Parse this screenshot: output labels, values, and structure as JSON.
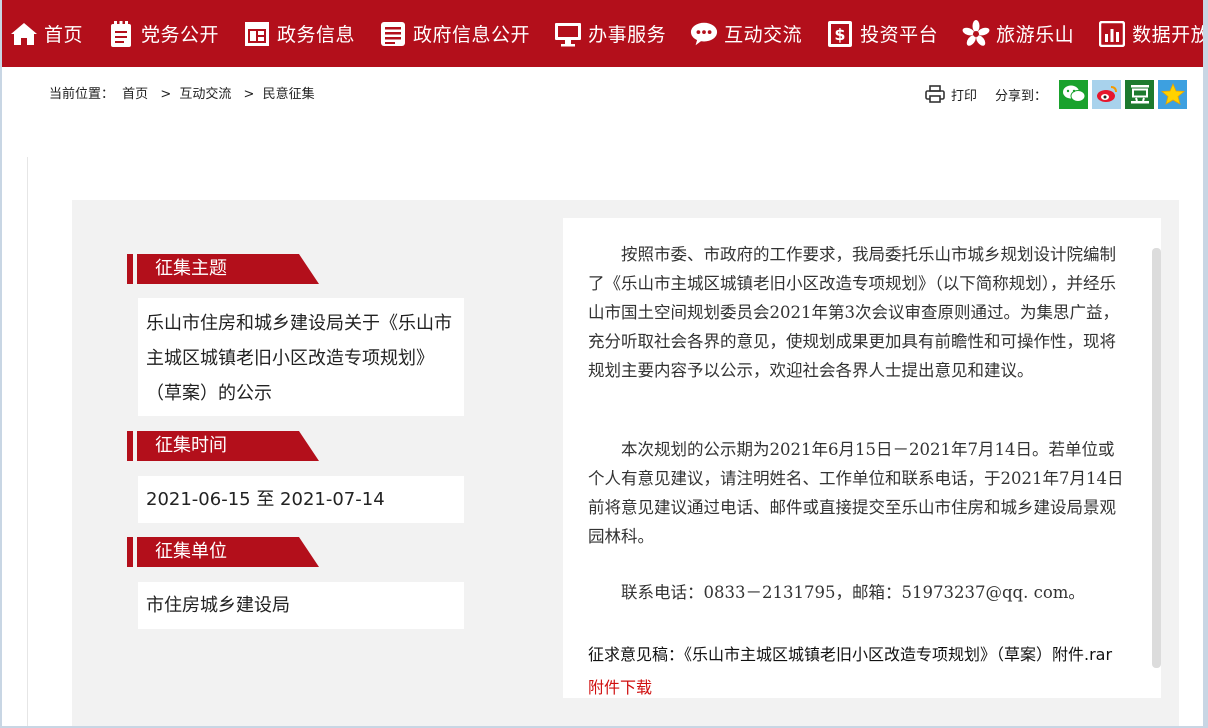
{
  "nav": {
    "items": [
      {
        "label": "首页",
        "icon": "home-icon"
      },
      {
        "label": "党务公开",
        "icon": "notepad-icon"
      },
      {
        "label": "政务信息",
        "icon": "window-layout-icon"
      },
      {
        "label": "政府信息公开",
        "icon": "list-document-icon"
      },
      {
        "label": "办事服务",
        "icon": "monitor-icon"
      },
      {
        "label": "互动交流",
        "icon": "chat-bubble-icon"
      },
      {
        "label": "投资平台",
        "icon": "money-document-icon"
      },
      {
        "label": "旅游乐山",
        "icon": "flower-icon"
      },
      {
        "label": "数据开放",
        "icon": "bar-chart-icon"
      }
    ],
    "color": "#b30f1b"
  },
  "breadcrumb": {
    "prefix": "当前位置：",
    "items": [
      "首页",
      "互动交流",
      "民意征集"
    ],
    "separator": ">"
  },
  "tools": {
    "print_label": "打印",
    "share_label": "分享到：",
    "share_buttons": [
      "wechat-icon",
      "weibo-icon",
      "douban-icon",
      "qzone-star-icon"
    ]
  },
  "sections": {
    "topic": {
      "title": "征集主题",
      "body": "乐山市住房和城乡建设局关于《乐山市主城区城镇老旧小区改造专项规划》（草案）的公示"
    },
    "time": {
      "title": "征集时间",
      "body": "2021-06-15 至 2021-07-14"
    },
    "unit": {
      "title": "征集单位",
      "body": "市住房城乡建设局"
    }
  },
  "article": {
    "p1": "按照市委、市政府的工作要求，我局委托乐山市城乡规划设计院编制了《乐山市主城区城镇老旧小区改造专项规划》（以下简称规划），并经乐山市国土空间规划委员会2021年第3次会议审查原则通过。为集思广益，充分听取社会各界的意见，使规划成果更加具有前瞻性和可操作性，现将规划主要内容予以公示，欢迎社会各界人士提出意见和建议。",
    "p2": "本次规划的公示期为2021年6月15日－2021年7月14日。若单位或个人有意见建议，请注明姓名、工作单位和联系电话，于2021年7月14日前将意见建议通过电话、邮件或直接提交至乐山市住房和城乡建设局景观园林科。",
    "p3": "联系电话：0833－2131795，邮箱：51973237@qq. com。",
    "attachment_text": "征求意见稿：《乐山市主城区城镇老旧小区改造专项规划》（草案）附件.rar",
    "download_label": "附件下载"
  },
  "colors": {
    "accent": "#b30f1b",
    "link": "#d01010",
    "panel_bg": "#f2f2f2"
  }
}
